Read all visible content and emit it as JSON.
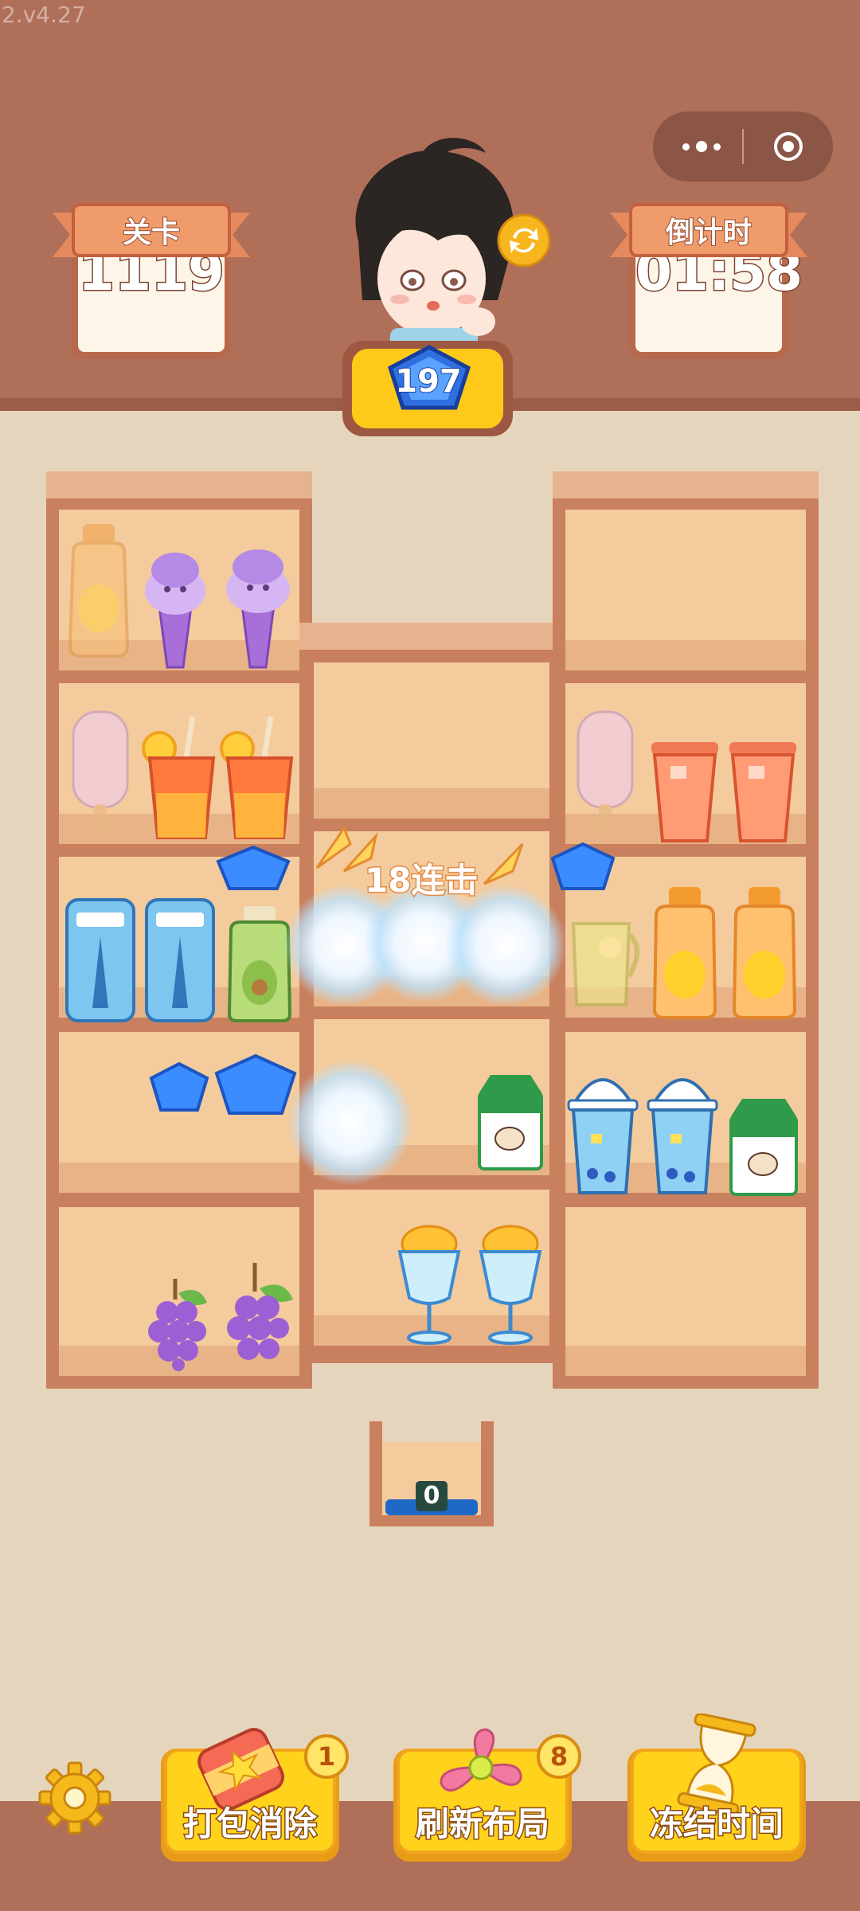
{
  "version": "2.v4.27",
  "level": {
    "label": "关卡",
    "value": "1119"
  },
  "timer": {
    "label": "倒计时",
    "value": "01:58"
  },
  "gems": {
    "count": "197"
  },
  "combo": {
    "text": "18连击"
  },
  "bin": {
    "count": "0"
  },
  "powerups": [
    {
      "label": "打包消除",
      "badge": "1",
      "icon": "soda-can-icon"
    },
    {
      "label": "刷新布局",
      "badge": "8",
      "icon": "pinwheel-icon"
    },
    {
      "label": "冻结时间",
      "badge": "",
      "icon": "hourglass-icon"
    }
  ],
  "colors": {
    "header": "#b06f58",
    "shelf": "#c9805e",
    "cell": "#f4cb9d",
    "button": "#ffd21c",
    "gem": "#3b8cff"
  }
}
